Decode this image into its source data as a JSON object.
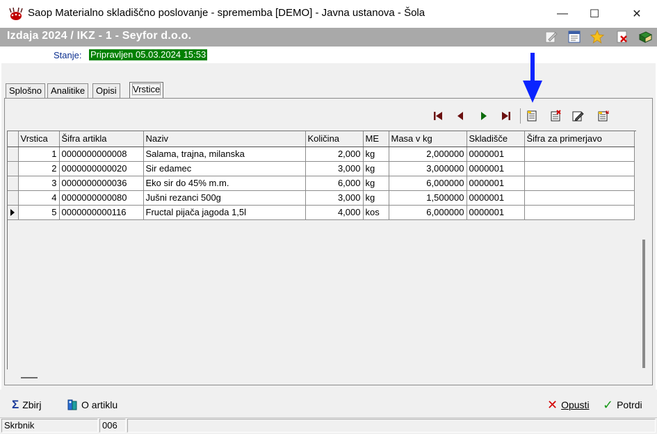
{
  "window": {
    "title": "Saop Materialno skladiščno poslovanje - sprememba [DEMO] - Javna ustanova - Šola",
    "minimize": "—",
    "maximize": "☐",
    "close": "✕"
  },
  "document": {
    "title": "Izdaja 2024 / IKZ - 1 - Seyfor d.o.o.",
    "toolbar_icons": [
      "edit-icon",
      "report-icon",
      "favorite-star-icon",
      "delete-document-icon",
      "book-icon"
    ]
  },
  "status": {
    "label": "Stanje:",
    "value": "Pripravljen 05.03.2024 15:53"
  },
  "tabs": [
    {
      "label": "Splošno"
    },
    {
      "label": "Analitike"
    },
    {
      "label": "Opisi"
    },
    {
      "label": "Vrstice",
      "active": true
    }
  ],
  "grid": {
    "columns": [
      "Vrstica",
      "Šifra artikla",
      "Naziv",
      "Količina",
      "ME",
      "Masa v kg",
      "Skladišče",
      "Šifra za primerjavo"
    ],
    "rows": [
      [
        "1",
        "0000000000008",
        "Salama, trajna, milanska",
        "2,000",
        "kg",
        "2,000000",
        "0000001",
        ""
      ],
      [
        "2",
        "0000000000020",
        "Sir edamec",
        "3,000",
        "kg",
        "3,000000",
        "0000001",
        ""
      ],
      [
        "3",
        "0000000000036",
        "Eko sir do 45% m.m.",
        "6,000",
        "kg",
        "6,000000",
        "0000001",
        ""
      ],
      [
        "4",
        "0000000000080",
        "Jušni rezanci 500g",
        "3,000",
        "kg",
        "1,500000",
        "0000001",
        ""
      ],
      [
        "5",
        "0000000000116",
        "Fructal pijača jagoda 1,5l",
        "4,000",
        "kos",
        "6,000000",
        "0000001",
        ""
      ]
    ],
    "current_row": 5
  },
  "buttons": {
    "zbiri": "Zbirj",
    "o_artiklu": "O artiklu",
    "opusti": "Opusti",
    "potrdi": "Potrdi"
  },
  "statusbar": {
    "user": "Skrbnik",
    "code": "006",
    "extra": ""
  },
  "colors": {
    "status_green": "#008000",
    "header_gray": "#a9a9a9",
    "arrow_blue": "#0a24ff"
  }
}
